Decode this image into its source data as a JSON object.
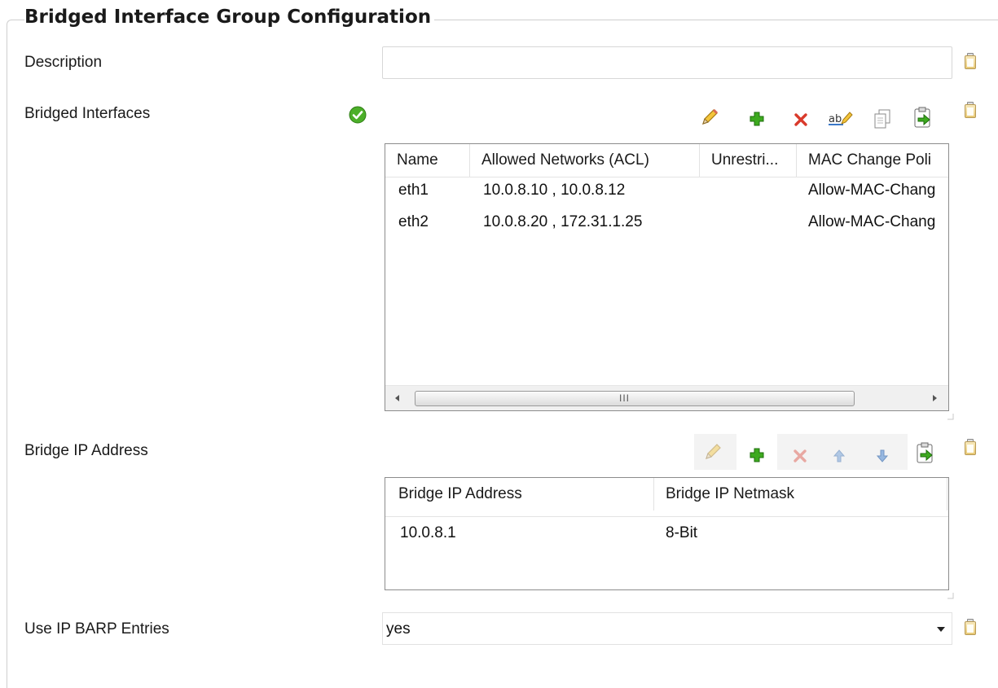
{
  "group": {
    "title": "Bridged Interface Group Configuration"
  },
  "fields": {
    "description": {
      "label": "Description",
      "value": ""
    },
    "bridged_interfaces": {
      "label": "Bridged Interfaces",
      "columns": [
        "Name",
        "Allowed Networks (ACL)",
        "Unrestri...",
        "MAC Change Poli"
      ],
      "rows": [
        {
          "name": "eth1",
          "acl": "10.0.8.10 , 10.0.8.12",
          "unrestricted": "",
          "mac_policy": "Allow-MAC-Chang"
        },
        {
          "name": "eth2",
          "acl": "10.0.8.20 , 172.31.1.25",
          "unrestricted": "",
          "mac_policy": "Allow-MAC-Chang"
        }
      ],
      "scrollbar_grip": "III"
    },
    "bridge_ip": {
      "label": "Bridge IP Address",
      "columns": [
        "Bridge IP Address",
        "Bridge IP Netmask"
      ],
      "rows": [
        {
          "address": "10.0.8.1",
          "netmask": "8-Bit"
        }
      ]
    },
    "use_ip_barp": {
      "label": "Use IP BARP Entries",
      "value": "yes"
    }
  },
  "icons": {
    "valid": "check-circle-icon",
    "clipboard": "clipboard-icon",
    "toolbar1": [
      "edit-icon",
      "add-icon",
      "delete-icon",
      "rename-icon",
      "copy-icon",
      "paste-icon"
    ],
    "toolbar2": [
      "edit-icon",
      "add-icon",
      "delete-icon",
      "move-up-icon",
      "move-down-icon",
      "paste-icon"
    ]
  },
  "colors": {
    "add": "#2e9a1a",
    "delete": "#d93a2b",
    "valid": "#4caf29",
    "arrow": "#6f9fd8"
  }
}
